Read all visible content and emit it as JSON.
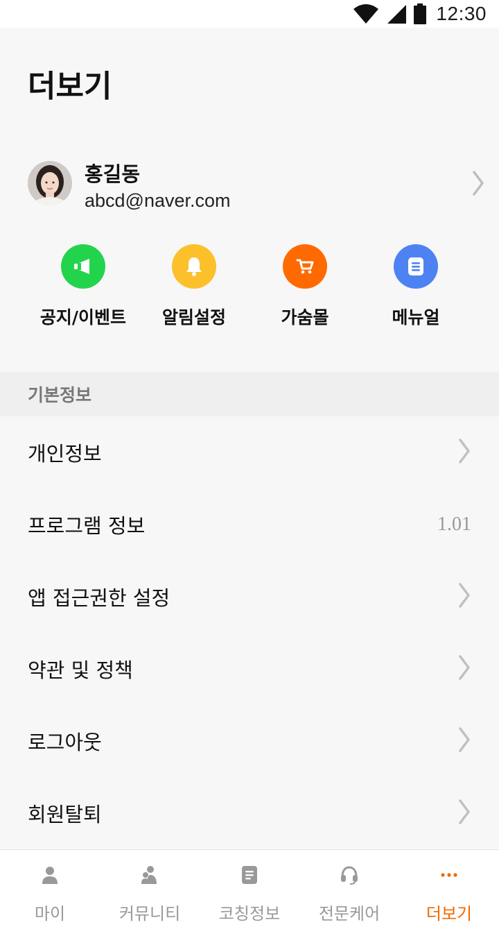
{
  "status_bar": {
    "time": "12:30",
    "icons": [
      "wifi-icon",
      "cellular-signal-icon",
      "battery-icon"
    ]
  },
  "page": {
    "title": "더보기"
  },
  "profile": {
    "name": "홍길동",
    "email": "abcd@naver.com"
  },
  "quick_menu": [
    {
      "label": "공지/이벤트",
      "icon": "megaphone-icon",
      "color": "#22d44c"
    },
    {
      "label": "알림설정",
      "icon": "bell-icon",
      "color": "#fcc02b"
    },
    {
      "label": "가숨몰",
      "icon": "cart-icon",
      "color": "#ff6a00"
    },
    {
      "label": "메뉴얼",
      "icon": "document-icon",
      "color": "#4d82f3"
    }
  ],
  "section": {
    "title": "기본정보"
  },
  "menu": [
    {
      "label": "개인정보",
      "trailing": "chevron-right-icon"
    },
    {
      "label": "프로그램 정보",
      "value": "1.01"
    },
    {
      "label": "앱 접근권한 설정",
      "trailing": "chevron-right-icon"
    },
    {
      "label": "약관 및 정책",
      "trailing": "chevron-right-icon"
    },
    {
      "label": "로그아웃",
      "trailing": "chevron-right-icon"
    },
    {
      "label": "회원탈퇴",
      "trailing": "chevron-right-icon"
    }
  ],
  "tabs": [
    {
      "label": "마이",
      "icon": "person-icon",
      "active": false
    },
    {
      "label": "커뮤니티",
      "icon": "people-icon",
      "active": false
    },
    {
      "label": "코칭정보",
      "icon": "document-icon",
      "active": false
    },
    {
      "label": "전문케어",
      "icon": "headset-icon",
      "active": false
    },
    {
      "label": "더보기",
      "icon": "more-dots-icon",
      "active": true
    }
  ],
  "colors": {
    "accent": "#f06a00",
    "inactive_tab": "#999999",
    "chevron": "#c0c0c0"
  }
}
